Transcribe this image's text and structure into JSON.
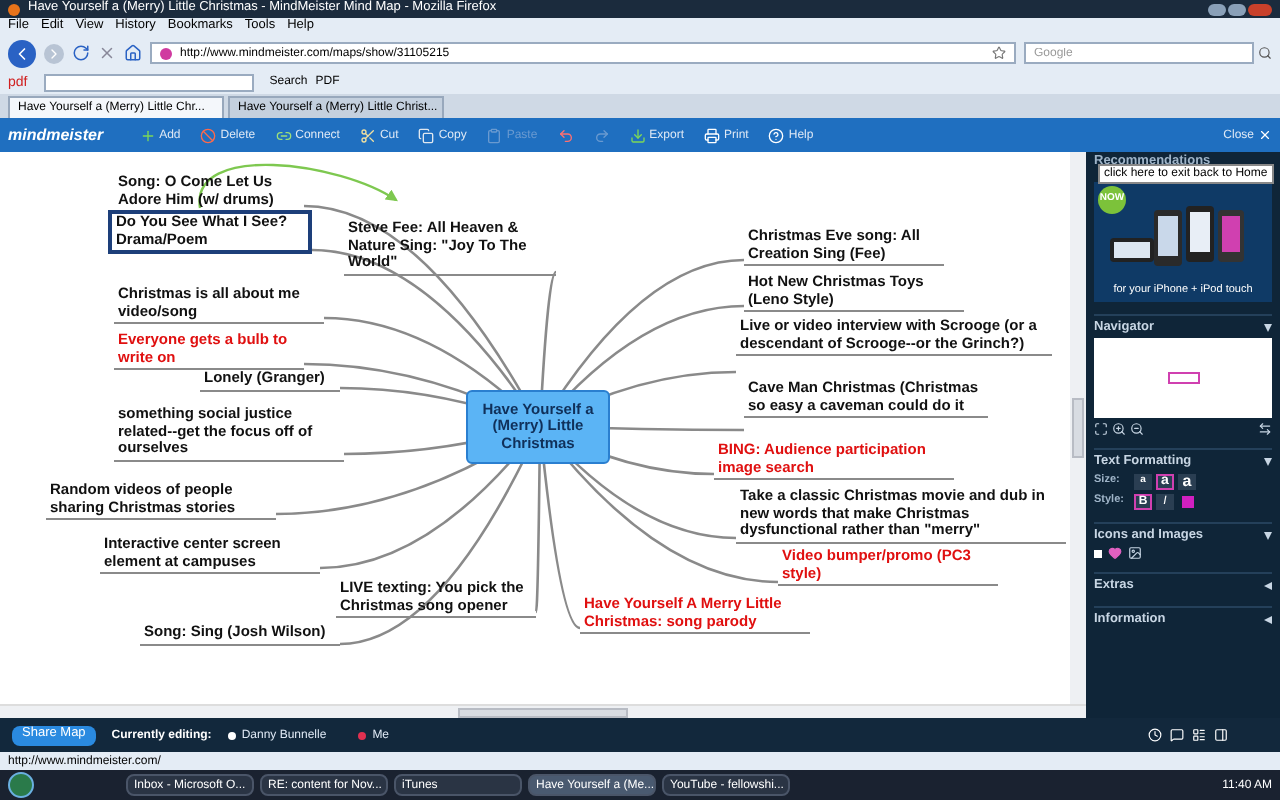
{
  "window": {
    "title": "Have Yourself a (Merry) Little Christmas - MindMeister Mind Map - Mozilla Firefox"
  },
  "menu": [
    "File",
    "Edit",
    "View",
    "History",
    "Bookmarks",
    "Tools",
    "Help"
  ],
  "address": "http://www.mindmeister.com/maps/show/31105215",
  "search": {
    "placeholder": "Google"
  },
  "pdf_toolbar": {
    "logo": "pdf",
    "search_label": "Search",
    "pdf_label": "PDF"
  },
  "tabs": [
    {
      "label": "Have Yourself a (Merry) Little Chr...",
      "selected": true
    },
    {
      "label": "Have Yourself a (Merry) Little Christ...",
      "selected": false
    }
  ],
  "app_toolbar": {
    "logo": "mindmeister",
    "buttons": [
      {
        "label": "Add",
        "disabled": false
      },
      {
        "label": "Delete",
        "disabled": false
      },
      {
        "label": "Connect",
        "disabled": false
      },
      {
        "label": "Cut",
        "disabled": false
      },
      {
        "label": "Copy",
        "disabled": false
      },
      {
        "label": "Paste",
        "disabled": true
      },
      {
        "label": "Export",
        "disabled": false
      },
      {
        "label": "Print",
        "disabled": false
      },
      {
        "label": "Help",
        "disabled": false
      }
    ],
    "close": "Close"
  },
  "map": {
    "center": "Have Yourself a (Merry) Little Christmas",
    "nodes": [
      {
        "text": "Song: O Come Let Us Adore Him (w/ drums)",
        "color": "#111111",
        "selected": false
      },
      {
        "text": "Do You See What I See? Drama/Poem",
        "color": "#111111",
        "selected": true
      },
      {
        "text": "Steve Fee: All Heaven & Nature Sing: \"Joy To The World\"",
        "color": "#111111",
        "selected": false
      },
      {
        "text": "Christmas is all about me video/song",
        "color": "#111111",
        "selected": false
      },
      {
        "text": "Everyone gets a bulb to write on",
        "color": "#e01010",
        "selected": false
      },
      {
        "text": "Lonely (Granger)",
        "color": "#111111",
        "selected": false
      },
      {
        "text": "something social justice related--get the focus off of ourselves",
        "color": "#111111",
        "selected": false
      },
      {
        "text": "Random videos of people sharing Christmas stories",
        "color": "#111111",
        "selected": false
      },
      {
        "text": "Interactive center screen element at campuses",
        "color": "#111111",
        "selected": false
      },
      {
        "text": "LIVE texting: You pick the Christmas song opener",
        "color": "#111111",
        "selected": false
      },
      {
        "text": "Song: Sing (Josh Wilson)",
        "color": "#111111",
        "selected": false
      },
      {
        "text": "Christmas Eve song: All Creation Sing (Fee)",
        "color": "#111111",
        "selected": false
      },
      {
        "text": "Hot New Christmas Toys (Leno Style)",
        "color": "#111111",
        "selected": false
      },
      {
        "text": "Live or video interview with Scrooge (or a descendant of Scrooge--or the Grinch?)",
        "color": "#111111",
        "selected": false
      },
      {
        "text": "Cave Man Christmas (Christmas so easy a caveman could do it",
        "color": "#111111",
        "selected": false
      },
      {
        "text": "BING: Audience participation image search",
        "color": "#e01010",
        "selected": false
      },
      {
        "text": "Take a classic Christmas movie and dub in new words that make Christmas dysfunctional rather than \"merry\"",
        "color": "#111111",
        "selected": false
      },
      {
        "text": "Video bumper/promo (PC3 style)",
        "color": "#e01010",
        "selected": false
      },
      {
        "text": "Have Yourself A Merry Little Christmas: song parody",
        "color": "#e01010",
        "selected": false
      }
    ]
  },
  "side_panel": {
    "header": "Recommendations",
    "tooltip": "click here to exit back to Home",
    "ad_badge": "NOW",
    "ad_caption": "for your iPhone + iPod touch",
    "sections": [
      {
        "title": "Navigator",
        "expanded": true
      },
      {
        "title": "Text Formatting",
        "expanded": true
      },
      {
        "title": "Icons and Images",
        "expanded": true
      },
      {
        "title": "Extras",
        "expanded": false
      },
      {
        "title": "Information",
        "expanded": false
      }
    ],
    "size_label": "Size:",
    "sizes": [
      {
        "label": "a",
        "selected": false
      },
      {
        "label": "a",
        "selected": true
      },
      {
        "label": "a",
        "selected": false
      }
    ],
    "style_label": "Style:",
    "bold": {
      "label": "B",
      "selected": true
    },
    "italic": {
      "label": "I",
      "selected": false
    },
    "text_color": {
      "color": "#d020c0"
    }
  },
  "bottom_bar": {
    "share": "Share Map",
    "editing_label": "Currently editing:",
    "editors": [
      {
        "name": "Danny Bunnelle",
        "color": "#ffffff"
      },
      {
        "name": "Me",
        "color": "#e03050"
      }
    ]
  },
  "status_bar": "http://www.mindmeister.com/",
  "taskbar": {
    "items": [
      {
        "label": "Inbox - Microsoft O...",
        "selected": false
      },
      {
        "label": "RE: content for Nov...",
        "selected": false
      },
      {
        "label": "iTunes",
        "selected": false
      },
      {
        "label": "Have Yourself a (Me...",
        "selected": true
      },
      {
        "label": "YouTube - fellowshi...",
        "selected": false
      }
    ],
    "clock": "11:40 AM"
  }
}
